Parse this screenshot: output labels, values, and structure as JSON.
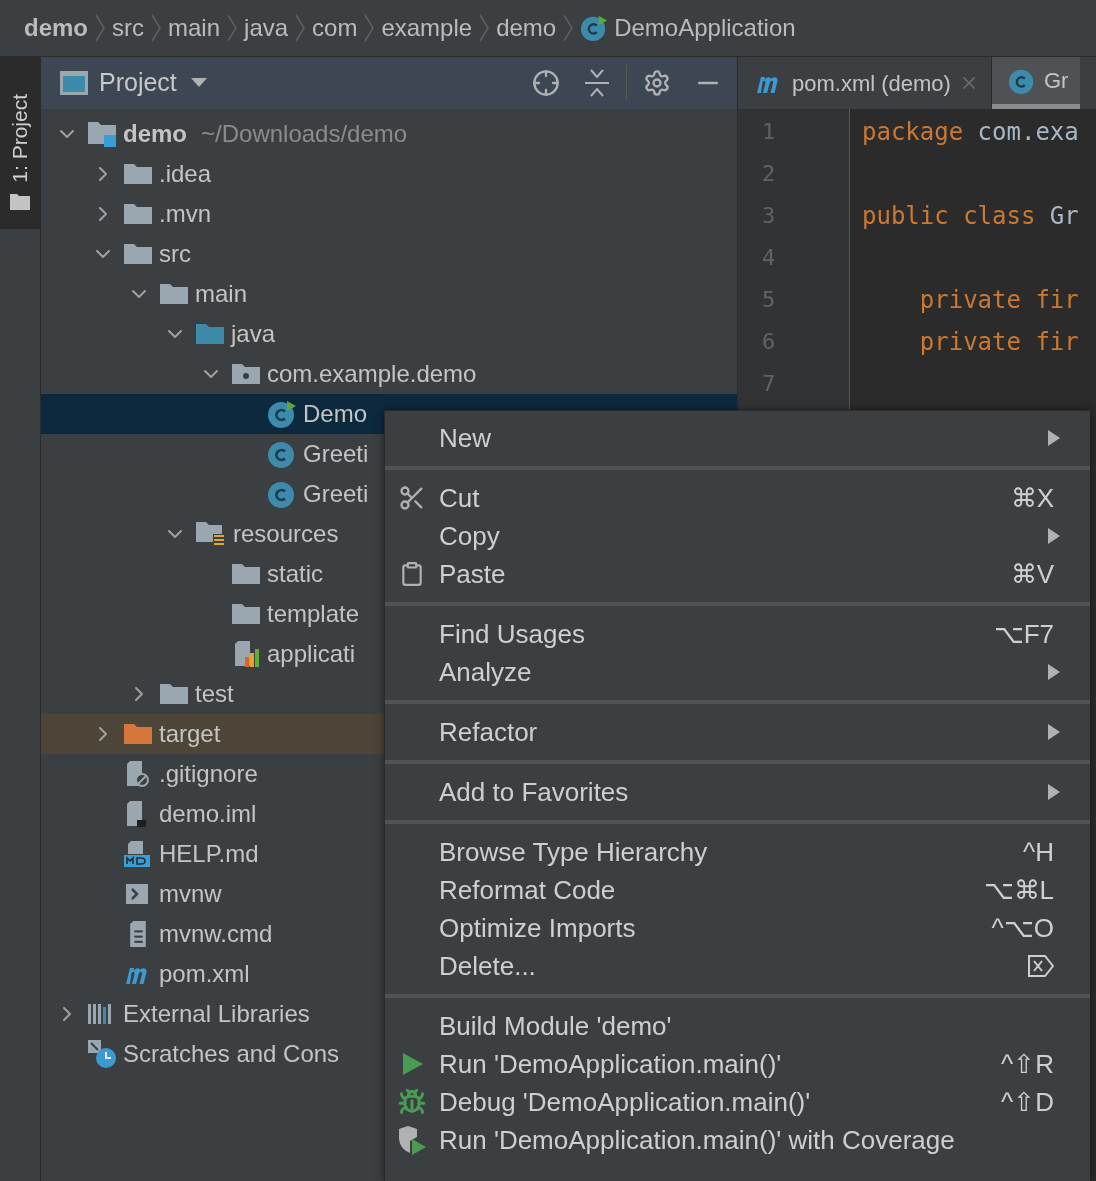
{
  "breadcrumbs": [
    {
      "label": "demo",
      "kind": "module"
    },
    {
      "label": "src",
      "kind": "directory"
    },
    {
      "label": "main",
      "kind": "directory"
    },
    {
      "label": "java",
      "kind": "directory"
    },
    {
      "label": "com",
      "kind": "directory"
    },
    {
      "label": "example",
      "kind": "directory"
    },
    {
      "label": "demo",
      "kind": "directory"
    },
    {
      "label": "DemoApplication",
      "kind": "main_class"
    }
  ],
  "tool_stripe": {
    "tab": {
      "label": "1: Project",
      "selected": true
    }
  },
  "project_panel": {
    "title": "Project",
    "tree": [
      {
        "label": "demo",
        "hint": "~/Downloads/demo",
        "kind": "module",
        "expanded": true,
        "selected": false,
        "children": [
          {
            "label": ".idea",
            "kind": "folder",
            "expanded": false,
            "selected": false
          },
          {
            "label": ".mvn",
            "kind": "folder",
            "expanded": false,
            "selected": false
          },
          {
            "label": "src",
            "kind": "folder",
            "expanded": true,
            "selected": false,
            "children": [
              {
                "label": "main",
                "kind": "folder",
                "expanded": true,
                "selected": false,
                "children": [
                  {
                    "label": "java",
                    "kind": "source_folder",
                    "expanded": true,
                    "selected": false,
                    "children": [
                      {
                        "label": "com.example.demo",
                        "kind": "package",
                        "expanded": true,
                        "selected": false,
                        "children": [
                          {
                            "label": "Demo",
                            "kind": "main_class",
                            "selected": true
                          },
                          {
                            "label": "Greeti",
                            "kind": "class",
                            "selected": false
                          },
                          {
                            "label": "Greeti",
                            "kind": "class",
                            "selected": false
                          }
                        ]
                      }
                    ]
                  },
                  {
                    "label": "resources",
                    "kind": "resources_folder",
                    "expanded": true,
                    "selected": false,
                    "children": [
                      {
                        "label": "static",
                        "kind": "folder",
                        "selected": false
                      },
                      {
                        "label": "template",
                        "kind": "folder",
                        "selected": false
                      },
                      {
                        "label": "applicati",
                        "kind": "properties",
                        "selected": false
                      }
                    ]
                  }
                ]
              },
              {
                "label": "test",
                "kind": "folder",
                "expanded": false,
                "selected": false
              }
            ]
          },
          {
            "label": "target",
            "kind": "excluded_folder",
            "expanded": false,
            "selected": false
          },
          {
            "label": ".gitignore",
            "kind": "ignore_file",
            "selected": false
          },
          {
            "label": "demo.iml",
            "kind": "iml_file",
            "selected": false
          },
          {
            "label": "HELP.md",
            "kind": "markdown",
            "selected": false
          },
          {
            "label": "mvnw",
            "kind": "shell",
            "selected": false
          },
          {
            "label": "mvnw.cmd",
            "kind": "text_file",
            "selected": false
          },
          {
            "label": "pom.xml",
            "kind": "maven",
            "selected": false
          }
        ]
      },
      {
        "label": "External Libraries",
        "kind": "libraries",
        "expanded": false,
        "selected": false
      },
      {
        "label": "Scratches and Cons",
        "kind": "scratches",
        "selected": false
      }
    ]
  },
  "editor": {
    "tabs": [
      {
        "label": "pom.xml (demo)",
        "kind": "maven",
        "selected": false,
        "closable": true
      },
      {
        "label": "Gr",
        "kind": "class",
        "selected": true,
        "closable": false
      }
    ],
    "lines": [
      {
        "number": "1",
        "tokens": [
          {
            "text": "package",
            "kind": "keyword"
          },
          {
            "text": " com.exa",
            "kind": "plain"
          }
        ]
      },
      {
        "number": "2"
      },
      {
        "number": "3",
        "tokens": [
          {
            "text": "public class",
            "kind": "keyword"
          },
          {
            "text": " Gr",
            "kind": "plain"
          }
        ]
      },
      {
        "number": "4"
      },
      {
        "number": "5",
        "tokens": [
          {
            "text": "    private fir",
            "kind": "keyword"
          }
        ]
      },
      {
        "number": "6",
        "tokens": [
          {
            "text": "    private fir",
            "kind": "keyword"
          }
        ]
      },
      {
        "number": "7"
      }
    ]
  },
  "context_menu": {
    "groups": [
      [
        {
          "label": "New",
          "kind": "plain",
          "submenu": true
        }
      ],
      [
        {
          "label": "Cut",
          "shortcut": "⌘X",
          "kind": "cut",
          "submenu": false
        },
        {
          "label": "Copy",
          "kind": "plain",
          "submenu": true
        },
        {
          "label": "Paste",
          "shortcut": "⌘V",
          "kind": "paste",
          "submenu": false
        }
      ],
      [
        {
          "label": "Find Usages",
          "shortcut": "⌥F7",
          "kind": "plain",
          "submenu": false
        },
        {
          "label": "Analyze",
          "kind": "plain",
          "submenu": true
        }
      ],
      [
        {
          "label": "Refactor",
          "kind": "plain",
          "submenu": true
        }
      ],
      [
        {
          "label": "Add to Favorites",
          "kind": "plain",
          "submenu": true
        }
      ],
      [
        {
          "label": "Browse Type Hierarchy",
          "shortcut": "^H",
          "kind": "plain",
          "submenu": false
        },
        {
          "label": "Reformat Code",
          "shortcut": "⌥⌘L",
          "kind": "plain",
          "submenu": false
        },
        {
          "label": "Optimize Imports",
          "shortcut": "^⌥O",
          "kind": "plain",
          "submenu": false
        },
        {
          "label": "Delete...",
          "kind": "delete",
          "submenu": false
        }
      ],
      [
        {
          "label": "Build Module 'demo'",
          "kind": "plain",
          "submenu": false
        },
        {
          "label": "Run 'DemoApplication.main()'",
          "shortcut": "^⇧R",
          "kind": "run",
          "submenu": false
        },
        {
          "label": "Debug 'DemoApplication.main()'",
          "shortcut": "^⇧D",
          "kind": "debug",
          "submenu": false
        },
        {
          "label": "Run 'DemoApplication.main()' with Coverage",
          "kind": "coverage",
          "submenu": false
        }
      ]
    ]
  }
}
